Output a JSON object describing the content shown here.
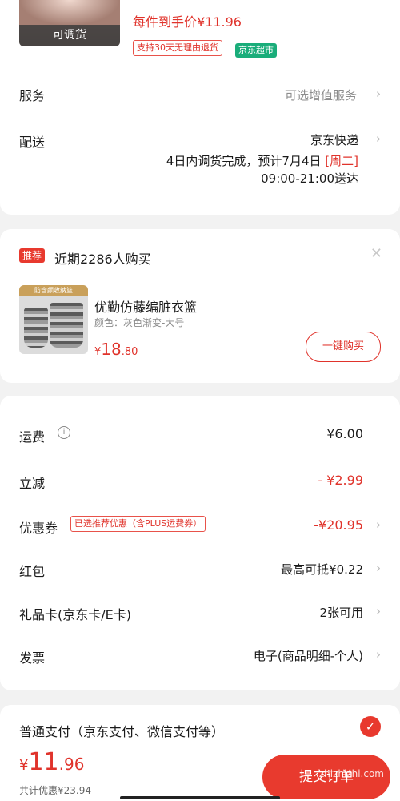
{
  "product": {
    "thumb_caption": "可调货",
    "price_label": "每件到手价¥11.96",
    "return_badge": "支持30天无理由退货",
    "store_badge": "京东超市"
  },
  "service": {
    "label": "服务",
    "value": "可选增值服务"
  },
  "delivery": {
    "label": "配送",
    "carrier": "京东快递",
    "eta_prefix": "4日内调货完成，预计7月4日",
    "eta_weekday": "[周二]",
    "eta_time": "09:00-21:00送达"
  },
  "recommend": {
    "tag": "推荐",
    "title": "近期2286人购买",
    "item_name": "优勤仿藤编脏衣篮",
    "item_spec": "颜色：灰色渐变-大号",
    "price_symbol": "¥",
    "price_int": "18",
    "price_dec": ".80",
    "buy_button": "一键购买",
    "image_caption": "防含颜收纳篮"
  },
  "fees": [
    {
      "label": "运费",
      "value": "¥6.00"
    },
    {
      "label": "立减",
      "value": "- ¥2.99"
    },
    {
      "label": "优惠券",
      "badge": "已选推荐优惠（含PLUS运费券）",
      "value": "-¥20.95"
    },
    {
      "label": "红包",
      "value": "最高可抵¥0.22"
    },
    {
      "label": "礼品卡(京东卡/E卡)",
      "value": "2张可用"
    },
    {
      "label": "发票",
      "value": "电子(商品明细-个人)"
    }
  ],
  "payment": {
    "method": "普通支付（京东支付、微信支付等）",
    "total_symbol": "¥",
    "total_int": "11",
    "total_dec": ".96",
    "saved": "共计优惠¥23.94",
    "submit": "提交订单"
  },
  "watermark": "zhizhizhi.com",
  "colors": {
    "accent": "#e8392e",
    "green": "#1aad7a"
  },
  "icons": {
    "chevron": "chevron-right-icon",
    "close": "close-icon",
    "info": "info-icon",
    "check": "check-circle-icon"
  }
}
